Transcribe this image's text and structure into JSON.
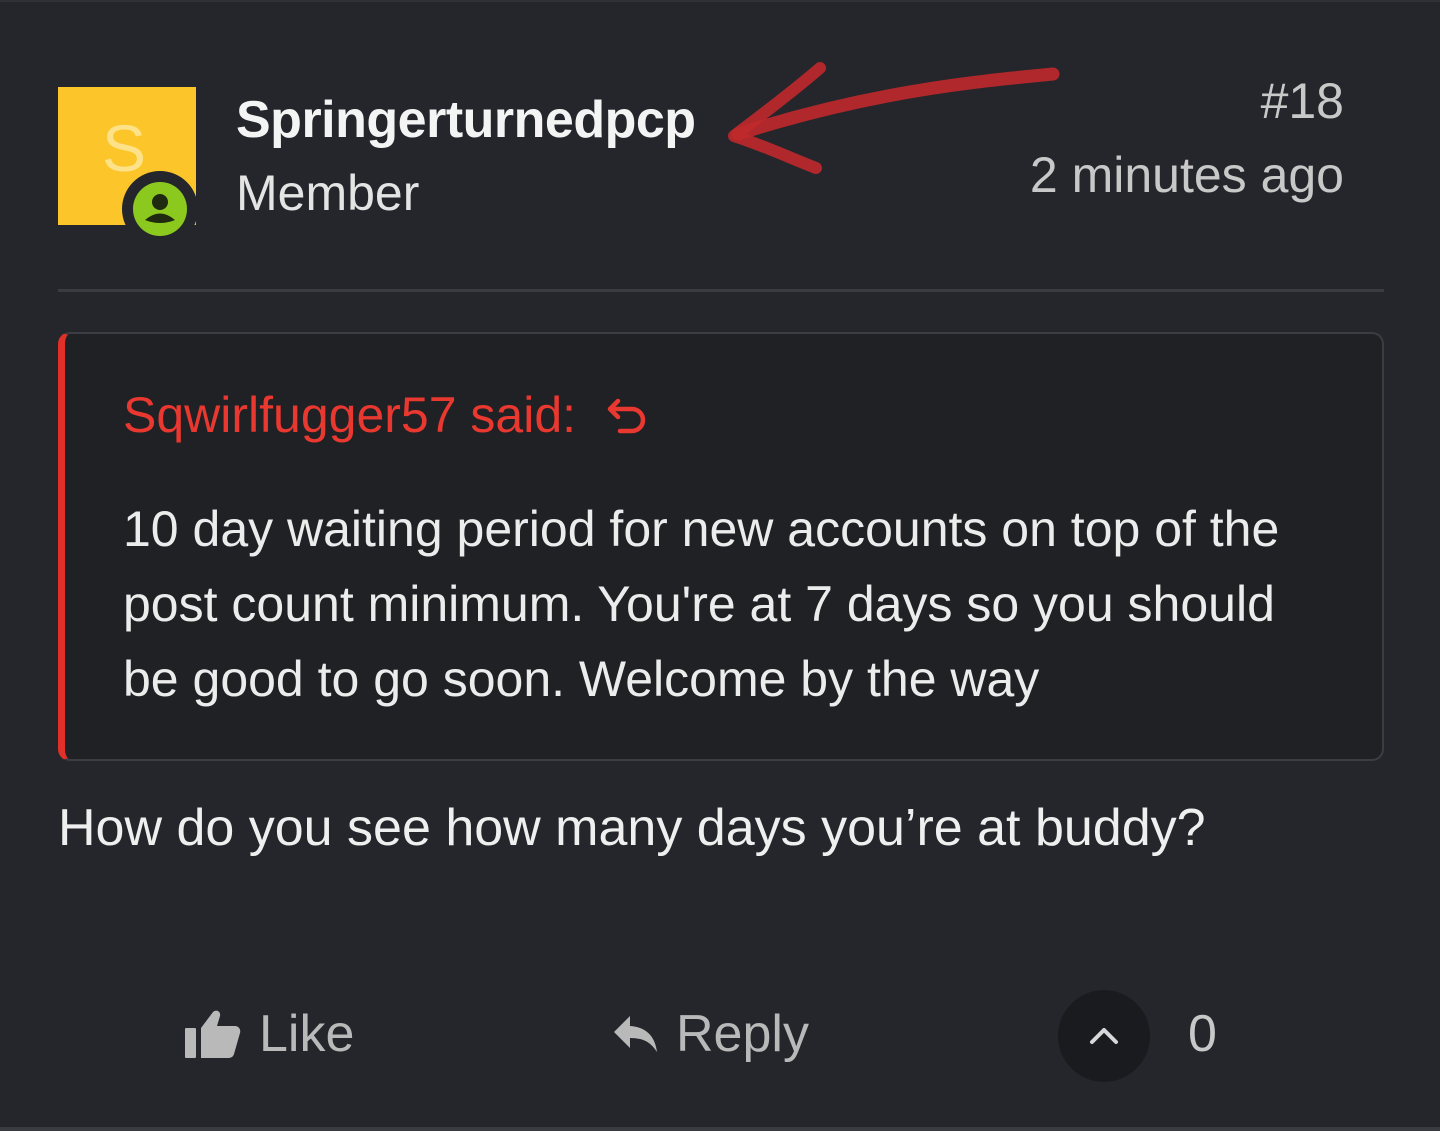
{
  "post": {
    "author": {
      "avatar_letter": "S",
      "avatar_color": "#fcc52a",
      "username": "Springerturnedpcp",
      "title": "Member",
      "status_icon": "online-user-icon",
      "status_color": "#8bc91e"
    },
    "annotation": {
      "icon": "red-hand-drawn-arrow-icon",
      "color": "#c0292b"
    },
    "number": "#18",
    "time": "2 minutes ago",
    "quote": {
      "attribution": "Sqwirlfugger57 said:",
      "jump_icon": "undo-arrow-icon",
      "accent_color": "#e0302a",
      "text": "10 day waiting period for new accounts on top of the post count minimum. You're at 7 days so you should be good to go soon. Welcome by the way"
    },
    "message": "How do you see how many days you’re at buddy?",
    "actions": {
      "like_label": "Like",
      "like_icon": "thumbs-up-icon",
      "reply_label": "Reply",
      "reply_icon": "reply-arrow-icon",
      "vote_icon": "chevron-up-icon",
      "vote_count": "0"
    }
  }
}
